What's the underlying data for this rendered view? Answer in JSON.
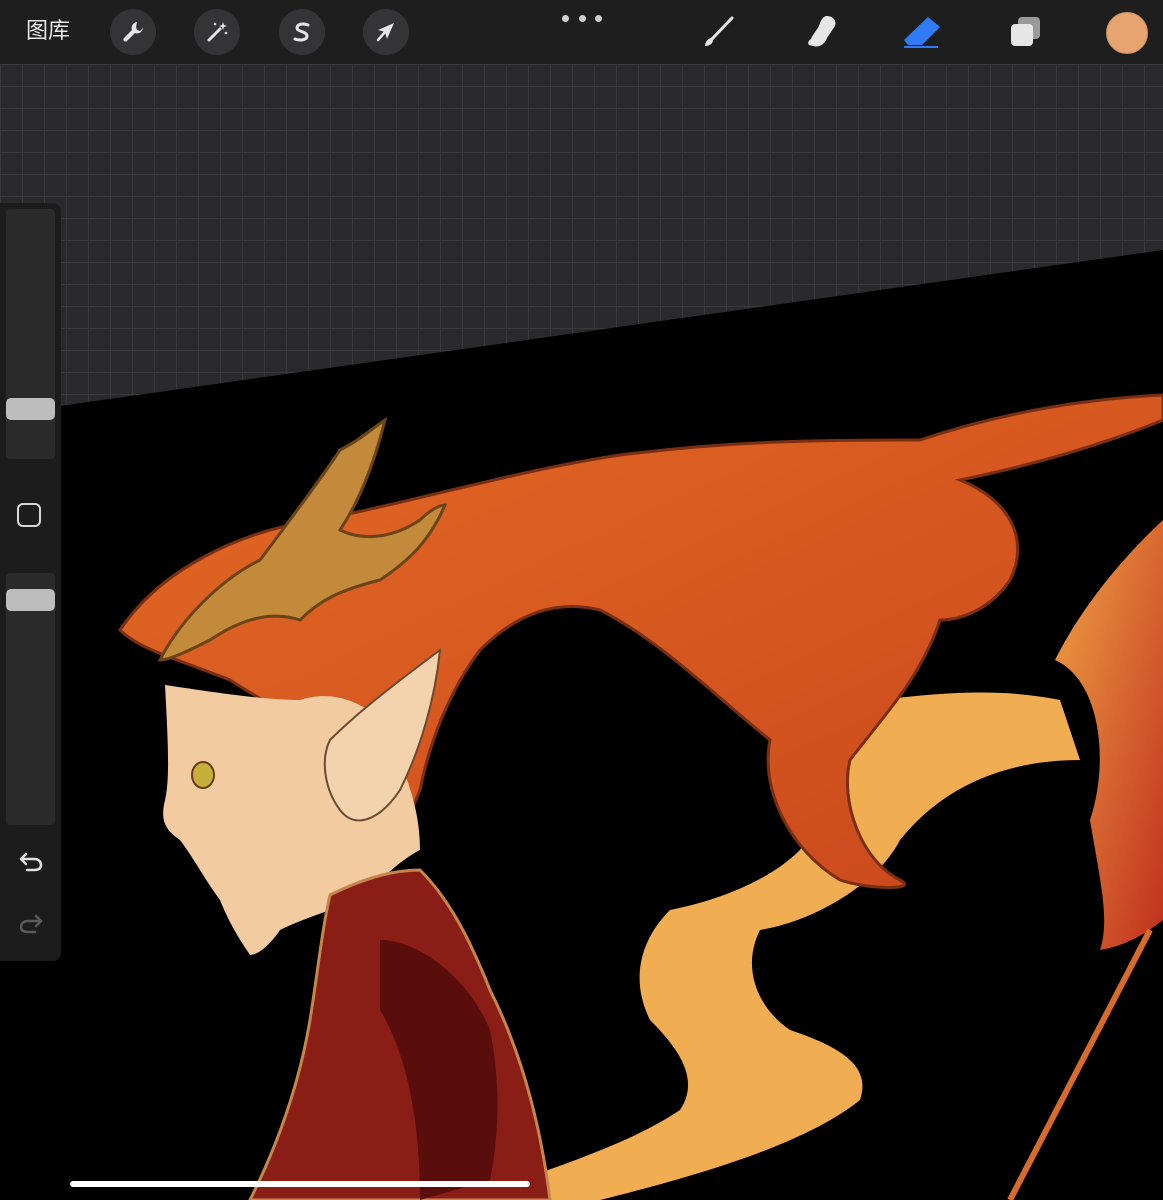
{
  "toolbar": {
    "gallery_label": "图库",
    "actions_icon": "wrench-icon",
    "adjustments_icon": "magic-wand-icon",
    "selection_icon": "selection-s-icon",
    "transform_icon": "arrow-cursor-icon",
    "more_icon": "more-dots-icon",
    "brush_icon": "brush-icon",
    "smudge_icon": "smudge-finger-icon",
    "eraser_icon": "eraser-icon",
    "layers_icon": "layers-icon",
    "active_tool": "eraser",
    "active_tool_color": "#2f7bf5",
    "current_color": "#e8a46e"
  },
  "sidebar": {
    "brush_size_level": 0.17,
    "opacity_level": 0.93,
    "modify_icon": "square-modify-icon",
    "undo_icon": "undo-arrow-icon",
    "redo_icon": "redo-arrow-icon"
  },
  "canvas": {
    "background": "#000000",
    "grid_background": "#2a2a2c"
  }
}
